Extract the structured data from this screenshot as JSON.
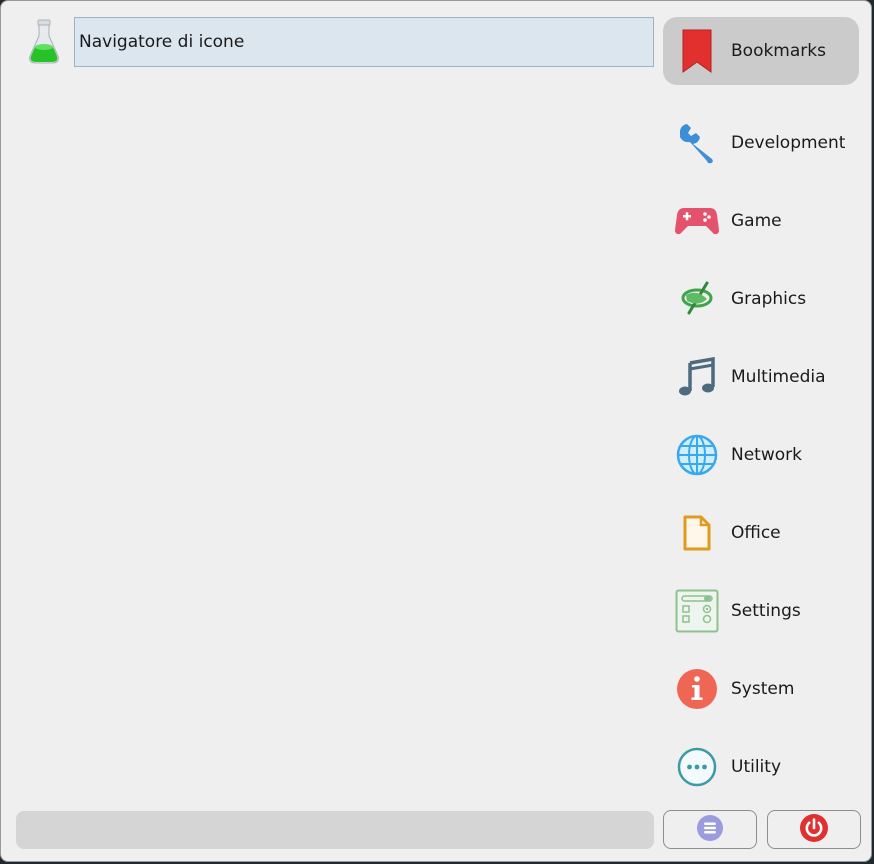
{
  "search": {
    "value": "Navigatore di icone"
  },
  "categories": [
    {
      "label": "Bookmarks",
      "icon": "bookmark-icon",
      "active": true
    },
    {
      "label": "Development",
      "icon": "wrench-icon"
    },
    {
      "label": "Game",
      "icon": "gamepad-icon"
    },
    {
      "label": "Graphics",
      "icon": "graphics-icon"
    },
    {
      "label": "Multimedia",
      "icon": "music-note-icon"
    },
    {
      "label": "Network",
      "icon": "globe-icon"
    },
    {
      "label": "Office",
      "icon": "document-icon"
    },
    {
      "label": "Settings",
      "icon": "settings-panel-icon"
    },
    {
      "label": "System",
      "icon": "info-icon"
    },
    {
      "label": "Utility",
      "icon": "more-dots-icon"
    }
  ],
  "footer": {
    "menu_icon": "menu-lines-icon",
    "power_icon": "power-icon"
  },
  "colors": {
    "window_bg": "#efefef",
    "active_category_bg": "#cbcbcb",
    "search_bg": "#dce6ee",
    "power_red": "#e03131",
    "menu_purple": "#9b9be0"
  }
}
